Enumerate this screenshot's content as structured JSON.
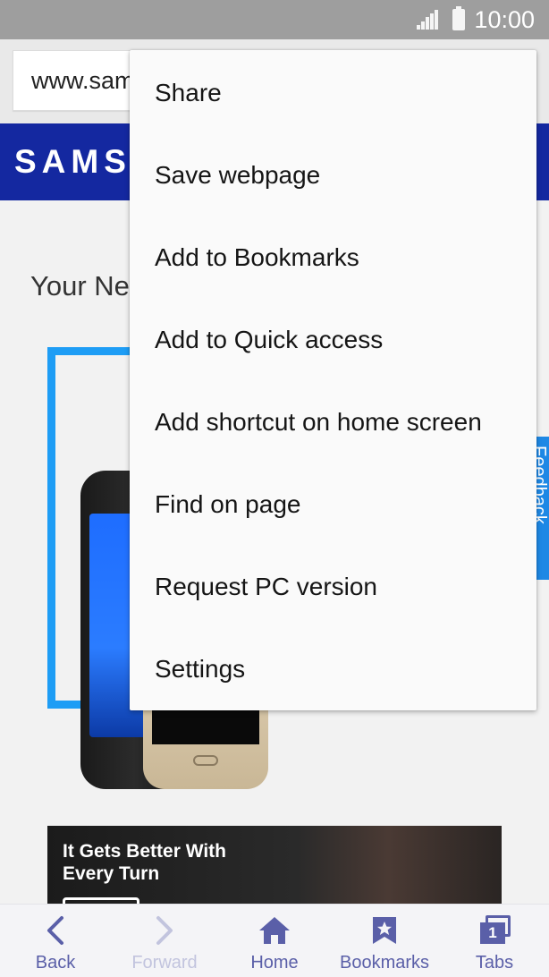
{
  "status_bar": {
    "time": "10:00"
  },
  "browser": {
    "url_visible": "www.sam"
  },
  "page": {
    "logo_text": "SAMSUNG",
    "headline_partial": "Your New",
    "feedback_tab": "Feedback",
    "ad_title": "It Gets Better With Every Turn"
  },
  "menu": {
    "items": [
      {
        "label": "Share"
      },
      {
        "label": "Save webpage"
      },
      {
        "label": "Add to Bookmarks"
      },
      {
        "label": "Add to Quick access"
      },
      {
        "label": "Add shortcut on home screen"
      },
      {
        "label": "Find on page"
      },
      {
        "label": "Request PC version"
      },
      {
        "label": "Settings"
      }
    ]
  },
  "bottom_nav": {
    "back": "Back",
    "forward": "Forward",
    "home": "Home",
    "bookmarks": "Bookmarks",
    "tabs": "Tabs",
    "tabs_count": "1"
  },
  "colors": {
    "accent": "#5a5fa8",
    "samsung_blue": "#1428a0",
    "promo_blue": "#1e9df5",
    "status_bar": "#9e9e9e"
  }
}
